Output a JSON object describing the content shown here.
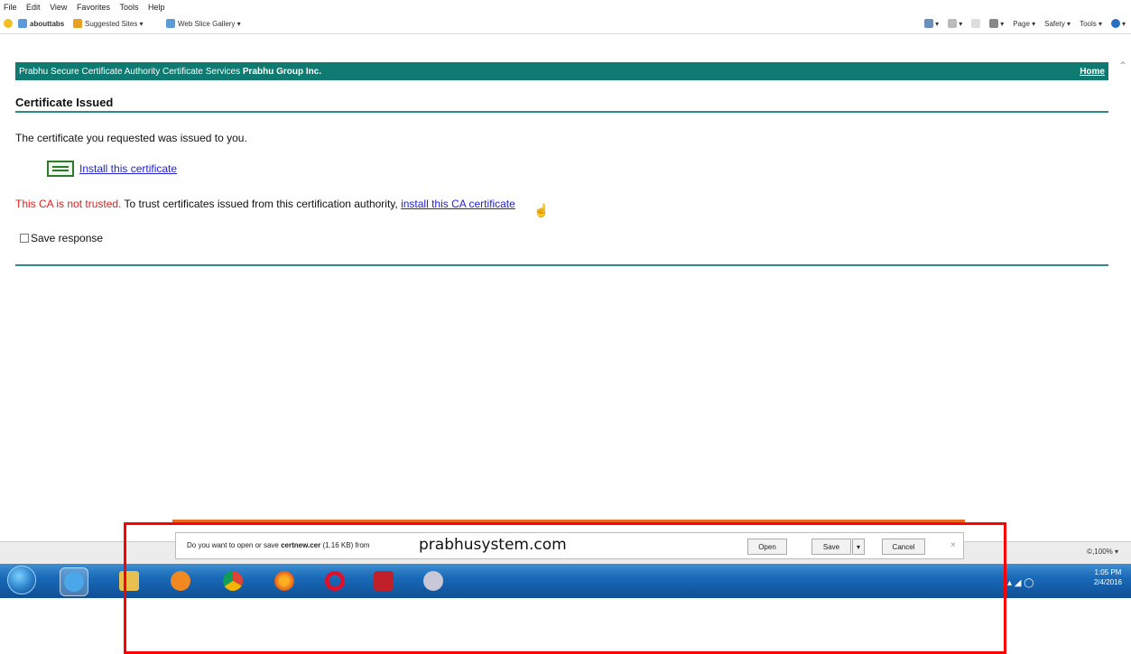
{
  "menu": [
    "File",
    "Edit",
    "View",
    "Favorites",
    "Tools",
    "Help"
  ],
  "favorites": {
    "items": [
      "abouttabs",
      "Suggested Sites ▾",
      "Web Slice Gallery ▾"
    ]
  },
  "command_bar": [
    "Page ▾",
    "Safety ▾",
    "Tools ▾"
  ],
  "page": {
    "header_text": "Prabhu Secure Certificate Authority Certificate Services",
    "header_org": "Prabhu Group Inc.",
    "home_link": "Home",
    "section_title": "Certificate Issued",
    "issued_text": "The certificate you requested was issued to you.",
    "install_link": "Install this certificate",
    "not_trusted": "This CA is not trusted.",
    "trust_text": " To trust certificates issued from this certification authority, ",
    "install_ca_link": "install this CA certificate",
    "save_response": "Save response"
  },
  "download_bar": {
    "message_prefix": "Do you want to open or save ",
    "filename": "certnew.cer",
    "size": " (1.16 KB) from ",
    "host": "prabhusystem.com",
    "open": "Open",
    "save": "Save",
    "save_dropdown": "▾",
    "cancel": "Cancel",
    "close": "×"
  },
  "status": {
    "zoom": "©,100%  ▾"
  },
  "tray": {
    "time": "1:05 PM",
    "date": "2/4/2016"
  },
  "colors": {
    "header_bg": "#0e7a72",
    "rule": "#2e8b84",
    "link": "#2121d8",
    "not_trusted": "#e02020",
    "highlight": "#ff0000"
  }
}
